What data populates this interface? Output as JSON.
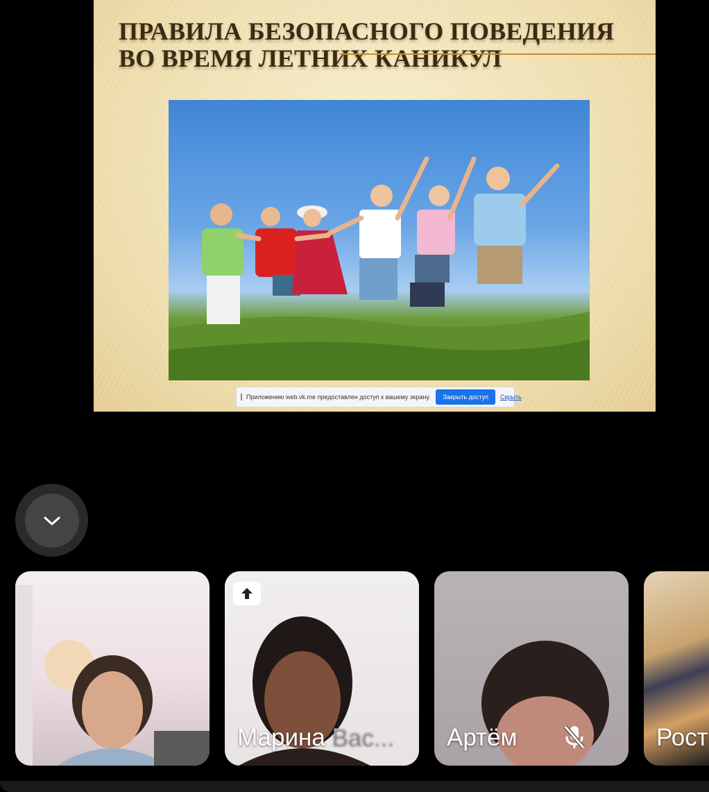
{
  "slide": {
    "title_line1": "ПРАВИЛА БЕЗОПАСНОГО ПОВЕДЕНИЯ",
    "title_line2": "ВО ВРЕМЯ ЛЕТНИХ КАНИКУЛ"
  },
  "screen_share_bar": {
    "message": "Приложению web.vk.me предоставлен доступ к вашему экрану.",
    "stop_label": "Закрыть доступ",
    "hide_label": "Скрыть"
  },
  "collapse_button": {
    "icon": "chevron-down-icon"
  },
  "participants": [
    {
      "name": "",
      "muted": false,
      "speaking": false
    },
    {
      "name_main": "Марина ",
      "name_faded": "Вас...",
      "muted": false,
      "speaking": true,
      "sharing_screen": true
    },
    {
      "name": "Артём",
      "muted": true,
      "speaking": false
    },
    {
      "name": "Рост",
      "muted": false,
      "speaking": false
    }
  ],
  "colors": {
    "active_speaker_border": "#4ccf5b",
    "share_button": "#1a73e8",
    "slide_title": "#3a2b14"
  }
}
